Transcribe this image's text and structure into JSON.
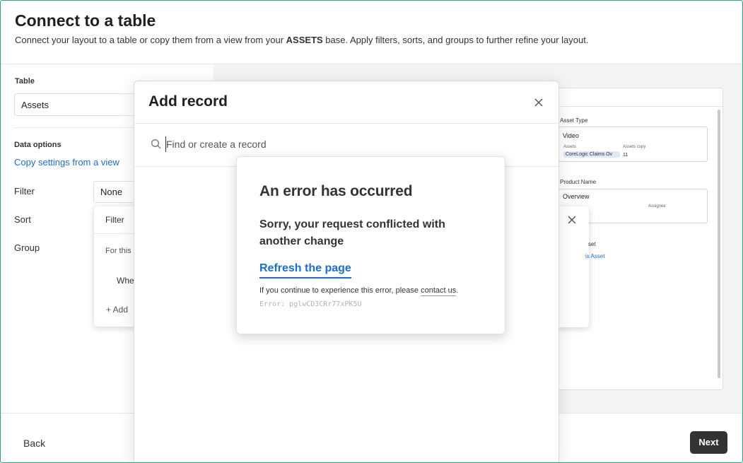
{
  "header": {
    "title": "Connect to a table",
    "subtitle_pre": "Connect your layout to a table or copy them from a view from your ",
    "subtitle_base": "ASSETS",
    "subtitle_post": " base. Apply filters, sorts, and groups to further refine your layout."
  },
  "left": {
    "table_label": "Table",
    "table_value": "Assets",
    "data_options_label": "Data options",
    "copy_link": "Copy settings from a view",
    "filter_label": "Filter",
    "filter_value": "None",
    "sort_label": "Sort",
    "group_label": "Group"
  },
  "filter_popover": {
    "title": "Filter",
    "for_text": "For this",
    "where_text": "Whe",
    "add_text": "+ Add"
  },
  "preview": {
    "asset_type_label": "Asset Type",
    "asset_type_value": "Video",
    "assets_sub": "Assets",
    "assets_copy_sub": "Assets copy",
    "chip": "CoreLogic Claims Ov",
    "assets_copy_value": "11",
    "product_name_label": "Product Name",
    "product_name_value": "Overview",
    "assignee_sub": "Assignee",
    "asset_partial": "set",
    "asset_link_partial": "is Asset"
  },
  "dialog": {
    "title": "Add record",
    "search_placeholder": "Find or create a record"
  },
  "error": {
    "title": "An error has occurred",
    "message": "Sorry, your request conflicted with another change",
    "refresh": "Refresh the page",
    "note_pre": "If you continue to experience this error, please ",
    "contact": "contact us",
    "note_post": ".",
    "code": "Error: pglwCD3CRr77xPK5U"
  },
  "footer": {
    "back": "Back",
    "next": "Next"
  },
  "icons": {
    "close": "close-icon",
    "search": "search-icon"
  },
  "colors": {
    "accent": "#166ee1",
    "next_bg": "#333333",
    "frame": "#2aa580"
  }
}
